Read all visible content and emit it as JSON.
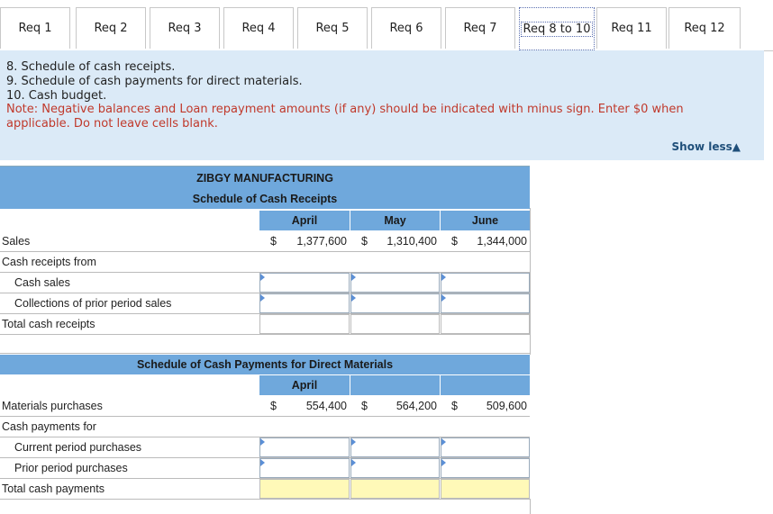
{
  "tabs": [
    {
      "label": "Req 1"
    },
    {
      "label": "Req 2"
    },
    {
      "label": "Req 3"
    },
    {
      "label": "Req 4"
    },
    {
      "label": "Req 5"
    },
    {
      "label": "Req 6"
    },
    {
      "label": "Req 7"
    },
    {
      "label": "Req 8 to 10"
    },
    {
      "label": "Req 11"
    },
    {
      "label": "Req 12"
    }
  ],
  "instructions": {
    "line1": "8. Schedule of cash receipts.",
    "line2": "9. Schedule of cash payments for direct materials.",
    "line3": "10. Cash budget.",
    "note": "Note: Negative balances and Loan repayment amounts (if any) should be indicated with minus sign. Enter $0 when applicable. Do not leave cells blank.",
    "show_less": "Show less▲"
  },
  "receipts": {
    "company": "ZIBGY MANUFACTURING",
    "title": "Schedule of Cash Receipts",
    "months": [
      "April",
      "May",
      "June"
    ],
    "sales_label": "Sales",
    "sales": [
      {
        "cur": "$",
        "val": "1,377,600"
      },
      {
        "cur": "$",
        "val": "1,310,400"
      },
      {
        "cur": "$",
        "val": "1,344,000"
      }
    ],
    "from_label": "Cash receipts from",
    "cash_sales_label": "Cash sales",
    "collections_label": "Collections of prior period sales",
    "total_label": "Total cash receipts"
  },
  "payments": {
    "title": "Schedule of Cash Payments for Direct Materials",
    "month": "April",
    "purchases_label": "Materials purchases",
    "purchases": [
      {
        "cur": "$",
        "val": "554,400"
      },
      {
        "cur": "$",
        "val": "564,200"
      },
      {
        "cur": "$",
        "val": "509,600"
      }
    ],
    "for_label": "Cash payments for",
    "current_label": "Current period purchases",
    "prior_label": "Prior period purchases",
    "total_label": "Total cash payments"
  }
}
